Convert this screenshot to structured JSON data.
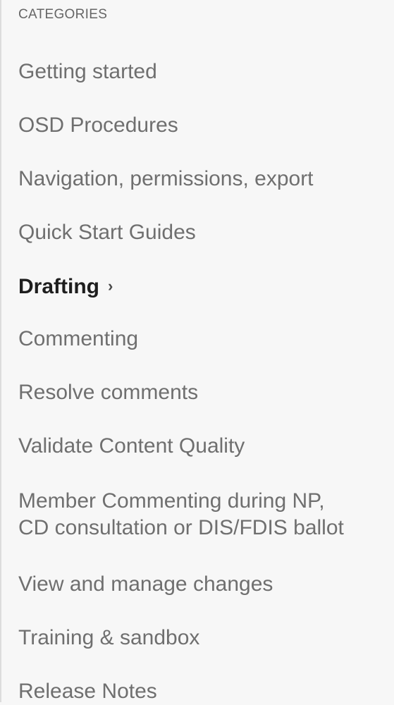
{
  "sidebar": {
    "heading": "CATEGORIES",
    "items": [
      {
        "label": "Getting started"
      },
      {
        "label": "OSD Procedures"
      },
      {
        "label": "Navigation, permissions, export"
      },
      {
        "label": "Quick Start Guides"
      },
      {
        "label": "Drafting",
        "active": true,
        "chevron": "›"
      },
      {
        "label": "Commenting"
      },
      {
        "label": "Resolve comments"
      },
      {
        "label": "Validate Content Quality"
      },
      {
        "label_line1": "Member Commenting during NP,",
        "label_line2": "CD consultation or DIS/FDIS ballot"
      },
      {
        "label": "View and manage changes"
      },
      {
        "label": "Training & sandbox"
      },
      {
        "label": "Release Notes"
      }
    ]
  },
  "colors": {
    "background": "#f7f7f7",
    "item_text": "#6f6f6f",
    "active_text": "#1e1e1e",
    "heading_text": "#666666"
  }
}
